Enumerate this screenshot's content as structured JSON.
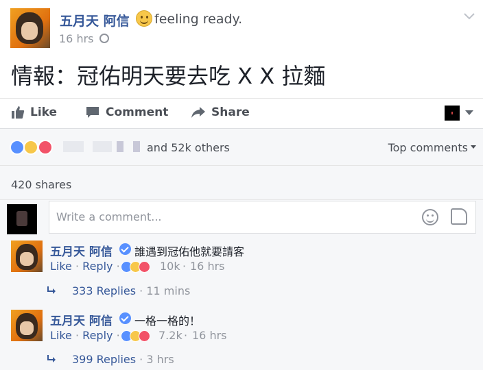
{
  "post": {
    "author": "五月天 阿信",
    "feeling": "feeling ready.",
    "time": "16 hrs",
    "text": "情報：冠佑明天要去吃 X X 拉麵"
  },
  "actions": {
    "like": "Like",
    "comment": "Comment",
    "share": "Share"
  },
  "reactions": {
    "summary": "and 52k others",
    "top_comments": "Top comments"
  },
  "shares": "420 shares",
  "composer": {
    "placeholder": "Write a comment..."
  },
  "comments": [
    {
      "author": "五月天 阿信",
      "text": "誰遇到冠佑他就要請客",
      "like": "Like",
      "reply": "Reply",
      "count": "10k",
      "time": "16 hrs",
      "replies": "333 Replies",
      "replies_time": "11 mins"
    },
    {
      "author": "五月天 阿信",
      "text": "一格一格的！",
      "like": "Like",
      "reply": "Reply",
      "count": "7.2k",
      "time": "16 hrs",
      "replies": "399 Replies",
      "replies_time": "3 hrs"
    }
  ],
  "colors": {
    "link": "#365899",
    "meta": "#90949c",
    "like_blue": "#5890ff",
    "love_red": "#f25268",
    "haha_yellow": "#f7c74a"
  },
  "icons": [
    "globe-icon",
    "chevron-down-icon",
    "like-icon",
    "comment-icon",
    "share-icon",
    "audience-icon",
    "like-reaction-icon",
    "haha-reaction-icon",
    "love-reaction-icon",
    "emoji-icon",
    "sticker-icon",
    "verified-icon",
    "reply-arrow-icon"
  ]
}
